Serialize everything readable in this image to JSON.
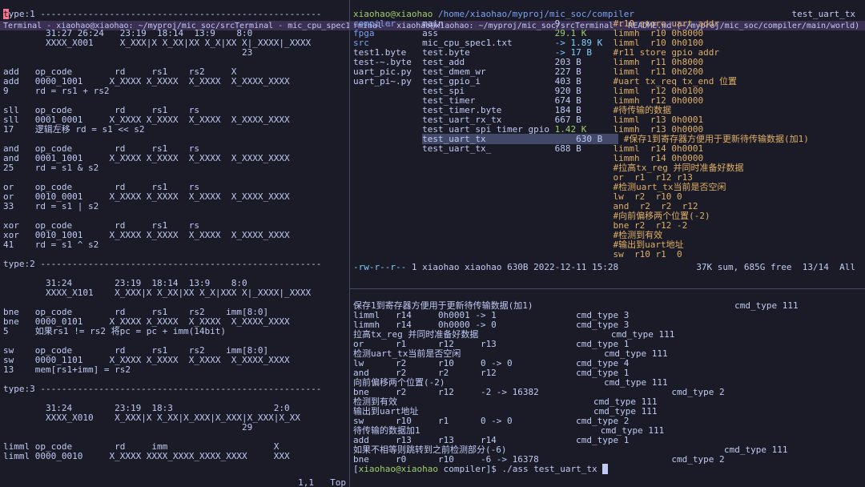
{
  "left_pane": {
    "titlebar_left": "Terminal - xiaohao@xiaohao: ~/myproj/mic_soc/src",
    "titlebar_center": "Terminal - mic_cpu_spec1.txt (~/myproj/mic_soc/src) - VIM",
    "lines": [
      {
        "r": "t",
        "text": "ype:1 -----------------------------------------------------"
      },
      {
        "text": ""
      },
      {
        "text": "        31:27 26:24   23:19  18:14  13:9    8:0"
      },
      {
        "text": "        XXXX_X001     X_XXX|X X_XX|XX X_X|XX X|_XXXX|_XXXX"
      },
      {
        "text": "                                             23"
      },
      {
        "text": ""
      },
      {
        "text": "add   op_code        rd     rs1    rs2     X"
      },
      {
        "text": "add   0000_1001     X_XXXX X_XXXX  X_XXXX  X_XXXX_XXXX"
      },
      {
        "text": "9     rd = rs1 + rs2"
      },
      {
        "text": ""
      },
      {
        "text": "sll   op_code        rd     rs1    rs"
      },
      {
        "text": "sll   0001_0001     X_XXXX X_XXXX  X_XXXX  X_XXXX_XXXX"
      },
      {
        "text": "17    逻辑左移 rd = s1 << s2"
      },
      {
        "text": ""
      },
      {
        "text": "and   op_code        rd     rs1    rs"
      },
      {
        "text": "and   0001_1001     X_XXXX X_XXXX  X_XXXX  X_XXXX_XXXX"
      },
      {
        "text": "25    rd = s1 & s2"
      },
      {
        "text": ""
      },
      {
        "text": "or    op_code        rd     rs1    rs"
      },
      {
        "text": "or    0010_0001     X_XXXX X_XXXX  X_XXXX  X_XXXX_XXXX"
      },
      {
        "text": "33    rd = s1 | s2"
      },
      {
        "text": ""
      },
      {
        "text": "xor   op_code        rd     rs1    rs"
      },
      {
        "text": "xor   0010_1001     X_XXXX X_XXXX  X_XXXX  X_XXXX_XXXX"
      },
      {
        "text": "41    rd = s1 ^ s2"
      },
      {
        "text": ""
      },
      {
        "text": "type:2 -----------------------------------------------------"
      },
      {
        "text": ""
      },
      {
        "text": "        31:24        23:19  18:14  13:9    8:0"
      },
      {
        "text": "        XXXX_X101    X_XXX|X X_XX|XX X_X|XXX X|_XXXX|_XXXX"
      },
      {
        "text": ""
      },
      {
        "text": "bne   op_code        rd     rs1    rs2    imm[8:0]"
      },
      {
        "text": "bne   0000_0101     X_XXXX X_XXXX  X_XXXX  X_XXXX_XXXX"
      },
      {
        "text": "5     如果rs1 != rs2 将pc = pc + imm(14bit)"
      },
      {
        "text": ""
      },
      {
        "text": "sw    op_code        rd     rs1    rs2    imm[8:0]"
      },
      {
        "text": "sw    0000_1101     X_XXXX X_XXXX  X_XXXX  X_XXXX_XXXX"
      },
      {
        "text": "13    mem[rs1+imm] = rs2"
      },
      {
        "text": ""
      },
      {
        "text": "type:3 -----------------------------------------------------"
      },
      {
        "text": ""
      },
      {
        "text": "        31:24        23:19  18:3                   2:0"
      },
      {
        "text": "        XXXX_X010    X_XXX|X X_XX|X_XXX|X_XXX|X_XXX|X_XX"
      },
      {
        "text": "                                             29"
      },
      {
        "text": ""
      },
      {
        "text": "limml op_code        rd     imm                    X"
      },
      {
        "text": "limml 0000_0010     X_XXXX XXXX_XXXX_XXXX_XXXX     XXX"
      }
    ],
    "status_pos": "1,1",
    "status_right": "Top"
  },
  "right_top_pane": {
    "titlebar_left": "rminal - xiaohao@xiaohao: ~/myproj/mic_soc/src",
    "titlebar_center": "Terminal - README.md (~/myproj/mic_soc/compiler/main/world) - VIM",
    "prompt_user": "xiaohao@xiaohao",
    "prompt_path": "/home/xiaohao/myproj/mic_soc/compiler",
    "file_lines": [
      {
        "c": "blue",
        "name": "compiler",
        "extra": "main",
        "size": "9",
        "rest": "#r10 store uart addr"
      },
      {
        "c": "blue",
        "name": "fpga",
        "extra": "ass",
        "size": "29.1 K",
        "rest": "limmh  r10 0h8000"
      },
      {
        "c": "blue",
        "name": "src",
        "extra": "mic_cpu_spec1.txt",
        "size": "-> 1.89 K",
        "rest": "limml  r10 0h0100"
      },
      {
        "c": "white",
        "name": "test1.byte",
        "extra": "test.byte",
        "size": "-> 17 B",
        "rest": "#r11 store gpio addr"
      },
      {
        "c": "white",
        "name": "test-~.byte",
        "extra": "test_add",
        "size": "203 B",
        "rest": "limmh  r11 0h8000"
      },
      {
        "c": "white",
        "name": "uart_pic.py",
        "extra": "test_dmem_wr",
        "size": "227 B",
        "rest": "limml  r11 0h0200"
      },
      {
        "c": "white",
        "name": "uart_pi~.py",
        "extra": "test_gpio_i",
        "size": "403 B",
        "rest": "#uart tx_req tx_end 位置"
      },
      {
        "c": "white",
        "name": "",
        "extra": "test_spi",
        "size": "920 B",
        "rest": "limml  r12 0h0100"
      },
      {
        "c": "white",
        "name": "",
        "extra": "test_timer",
        "size": "674 B",
        "rest": "limmh  r12 0h0000"
      },
      {
        "c": "white",
        "name": "",
        "extra": "test_timer.byte",
        "size": "184 B",
        "rest": "#待传输的数据"
      },
      {
        "c": "white",
        "name": "",
        "extra": "test_uart_rx_tx",
        "size": "667 B",
        "rest": "limml  r13 0h0001"
      },
      {
        "c": "white",
        "name": "",
        "extra": "test_uart_spi_timer_gpio",
        "size": "1.42 K",
        "rest": "limmh  r13 0h0000"
      },
      {
        "c": "highlight",
        "name": "",
        "extra": "test_uart_tx",
        "size": "630 B",
        "rest": "#保存1到寄存器方便用于更新待传输数据(加1)"
      },
      {
        "c": "white",
        "name": "",
        "extra": "test_uart_tx_",
        "size": "688 B",
        "rest": "limml  r14 0h0001"
      },
      {
        "c": "white",
        "name": "",
        "extra": "",
        "size": "",
        "rest": "limmh  r14 0h0000"
      },
      {
        "c": "white",
        "name": "",
        "extra": "",
        "size": "",
        "rest": "#拉高tx_reg 并同时准备好数据"
      },
      {
        "c": "white",
        "name": "",
        "extra": "",
        "size": "",
        "rest": "or  r1  r12 r13"
      },
      {
        "c": "white",
        "name": "",
        "extra": "",
        "size": "",
        "rest": "#检测uart_tx当前是否空闲"
      },
      {
        "c": "white",
        "name": "",
        "extra": "",
        "size": "",
        "rest": "lw  r2  r10 0"
      },
      {
        "c": "white",
        "name": "",
        "extra": "",
        "size": "",
        "rest": "and  r2  r2  r12"
      },
      {
        "c": "white",
        "name": "",
        "extra": "",
        "size": "",
        "rest": "#向前偏移两个位置(-2)"
      },
      {
        "c": "white",
        "name": "",
        "extra": "",
        "size": "",
        "rest": "bne r2  r12 -2"
      },
      {
        "c": "white",
        "name": "",
        "extra": "",
        "size": "",
        "rest": "#检测到有效"
      },
      {
        "c": "white",
        "name": "",
        "extra": "",
        "size": "",
        "rest": "#输出到uart地址"
      },
      {
        "c": "white",
        "name": "",
        "extra": "",
        "size": "",
        "rest": "sw  r10 r1  0"
      }
    ],
    "footer_perm": "-rw-r--r--",
    "footer_owner": "1 xiaohao xiaohao 630B 2022-12-11 15:28",
    "footer_right": "37K sum, 685G free  13/14  All",
    "dir_title": "test_uart_tx"
  },
  "right_bottom_pane": {
    "lines": [
      {
        "a": "保存1到寄存器方便用于更新待传输数据(加1)",
        "b": "",
        "c": "cmd_type 111"
      },
      {
        "a": "limml   r14     0h0001 -> 1",
        "b": "cmd_type 3",
        "c": ""
      },
      {
        "a": "limmh   r14     0h0000 -> 0",
        "b": "cmd_type 3",
        "c": ""
      },
      {
        "a": "拉高tx_reg 并同时准备好数据",
        "b": "cmd_type 111",
        "c": ""
      },
      {
        "a": "or      r1      r12     r13",
        "b": "cmd_type 1",
        "c": ""
      },
      {
        "a": "检测uart_tx当前是否空闲",
        "b": "cmd_type 111",
        "c": ""
      },
      {
        "a": "lw      r2      r10     0 -> 0",
        "b": "cmd_type 4",
        "c": ""
      },
      {
        "a": "and     r2      r2      r12",
        "b": "cmd_type 1",
        "c": ""
      },
      {
        "a": "向前偏移两个位置(-2)",
        "b": "cmd_type 111",
        "c": ""
      },
      {
        "a": "bne     r2      r12     -2 -> 16382",
        "b": "",
        "c": "cmd_type 2"
      },
      {
        "a": "检测到有效",
        "b": "cmd_type 111",
        "c": ""
      },
      {
        "a": "输出到uart地址",
        "b": "cmd_type 111",
        "c": ""
      },
      {
        "a": "sw      r10     r1      0 -> 0",
        "b": "cmd_type 2",
        "c": ""
      },
      {
        "a": "待传输的数据加1",
        "b": "cmd_type 111",
        "c": ""
      },
      {
        "a": "add     r13     r13     r14",
        "b": "cmd_type 1",
        "c": ""
      },
      {
        "a": "如果不相等则跳转到之前检测部分(-6)",
        "b": "",
        "c": "cmd_type 111"
      },
      {
        "a": "bne     r0      r10     -6 -> 16378",
        "b": "",
        "c": "cmd_type 2"
      }
    ],
    "prompt_user": "xiaohao@xiaohao",
    "prompt_dir": "compiler",
    "prompt_cmd": "./ass test_uart_tx"
  }
}
